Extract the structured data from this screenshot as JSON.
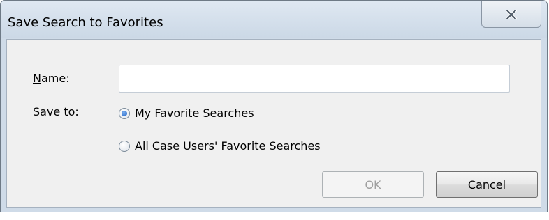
{
  "dialog": {
    "title": "Save Search to Favorites",
    "close_icon": "close-x-icon"
  },
  "form": {
    "name_label_accel": "N",
    "name_label_rest": "ame:",
    "name_value": "",
    "save_to_label": "Save to:",
    "options": [
      {
        "label": "My Favorite Searches",
        "selected": true
      },
      {
        "label": "All Case Users' Favorite Searches",
        "selected": false
      }
    ]
  },
  "buttons": {
    "ok_label": "OK",
    "ok_enabled": false,
    "cancel_label": "Cancel"
  }
}
